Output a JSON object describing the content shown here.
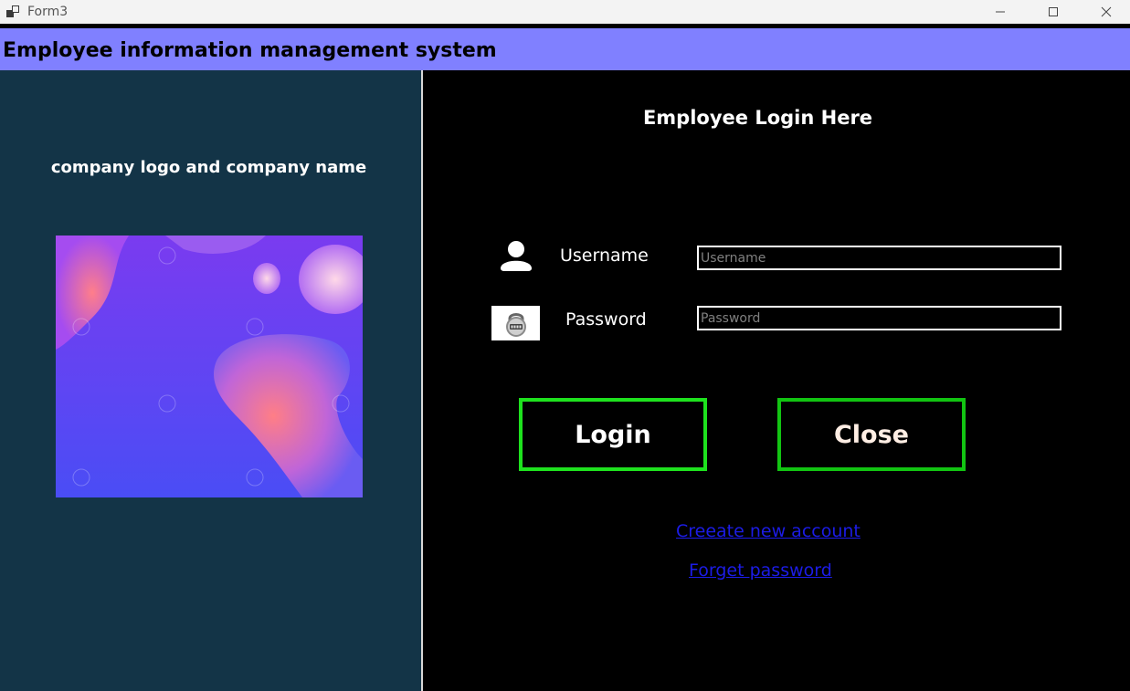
{
  "window": {
    "title": "Form3",
    "icon": "app-window-icon"
  },
  "header": {
    "title": "Employee information management system",
    "background": "#8080ff"
  },
  "left_panel": {
    "label": "company logo and company name",
    "background": "#133447",
    "image_icon": "abstract-gradient-logo-image"
  },
  "login": {
    "heading": "Employee Login Here",
    "username_label": "Username",
    "username_placeholder": "Username",
    "username_value": "",
    "password_label": "Password",
    "password_placeholder": "Password",
    "password_value": "",
    "login_button": "Login",
    "close_button": "Close",
    "create_account_link": "Creeate new account",
    "forget_password_link": "Forget password",
    "login_border_color": "#1ee21e",
    "close_border_color": "#12c412",
    "link_color": "#1c1ce6"
  }
}
